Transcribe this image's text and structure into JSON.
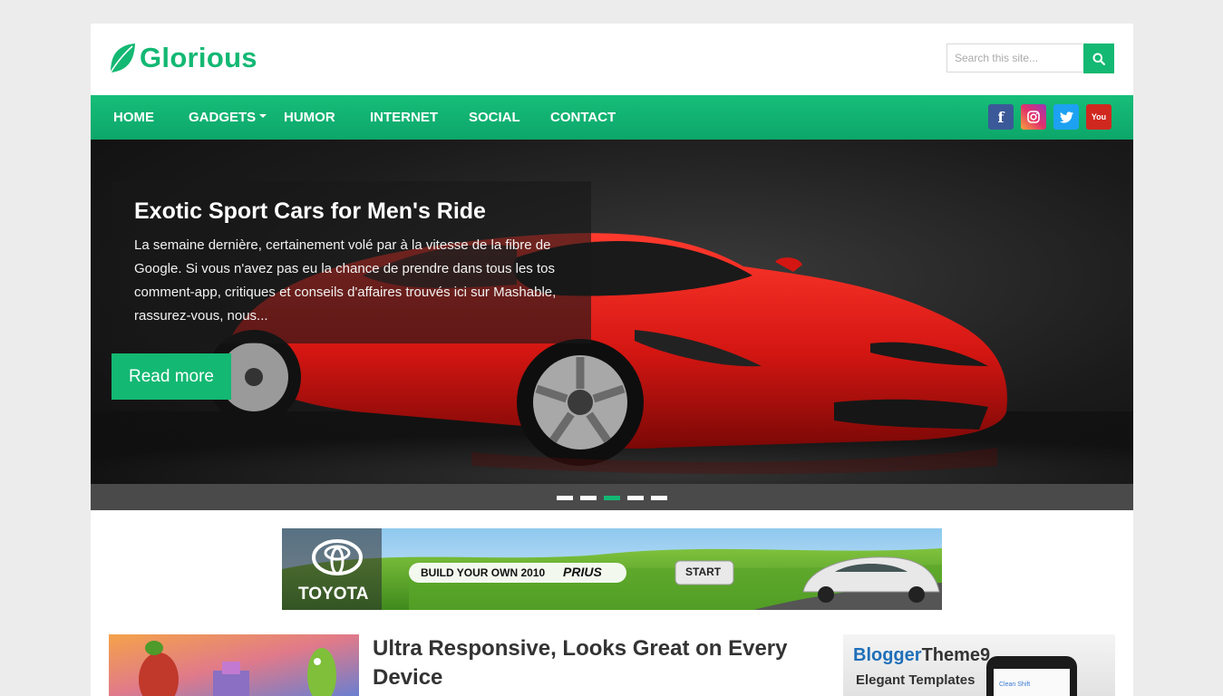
{
  "site": {
    "name": "Glorious"
  },
  "search": {
    "placeholder": "Search this site..."
  },
  "nav": {
    "items": [
      {
        "label": "HOME"
      },
      {
        "label": "GADGETS"
      },
      {
        "label": "HUMOR"
      },
      {
        "label": "INTERNET"
      },
      {
        "label": "SOCIAL"
      },
      {
        "label": "CONTACT"
      }
    ],
    "social": {
      "facebook": "f",
      "twitter": "twitter-icon",
      "instagram": "instagram-icon",
      "youtube": "You"
    }
  },
  "slider": {
    "title": "Exotic Sport Cars for Men's Ride",
    "excerpt": "La semaine dernière, certainement volé par à la vitesse de la fibre de Google. Si vous n'avez pas eu la chance de prendre dans tous les tos comment-app, critiques et conseils d'affaires trouvés ici sur Mashable, rassurez-vous, nous...",
    "read_more": "Read more",
    "slide_count": 5,
    "active_slide": 3
  },
  "banner_ad": {
    "brand": "TOYOTA",
    "tagline": "BUILD YOUR OWN 2010",
    "model": "PRIUS",
    "cta": "START"
  },
  "post": {
    "title": "Ultra Responsive, Looks Great on Every Device"
  },
  "sidebar_ad": {
    "brand_part1": "Blogger",
    "brand_part2": "Theme9",
    "subtitle": "Elegant Templates",
    "screen_text": "Clean Shift"
  },
  "colors": {
    "accent": "#13b873",
    "nav": "#10b070",
    "page_bg": "#ececec"
  }
}
